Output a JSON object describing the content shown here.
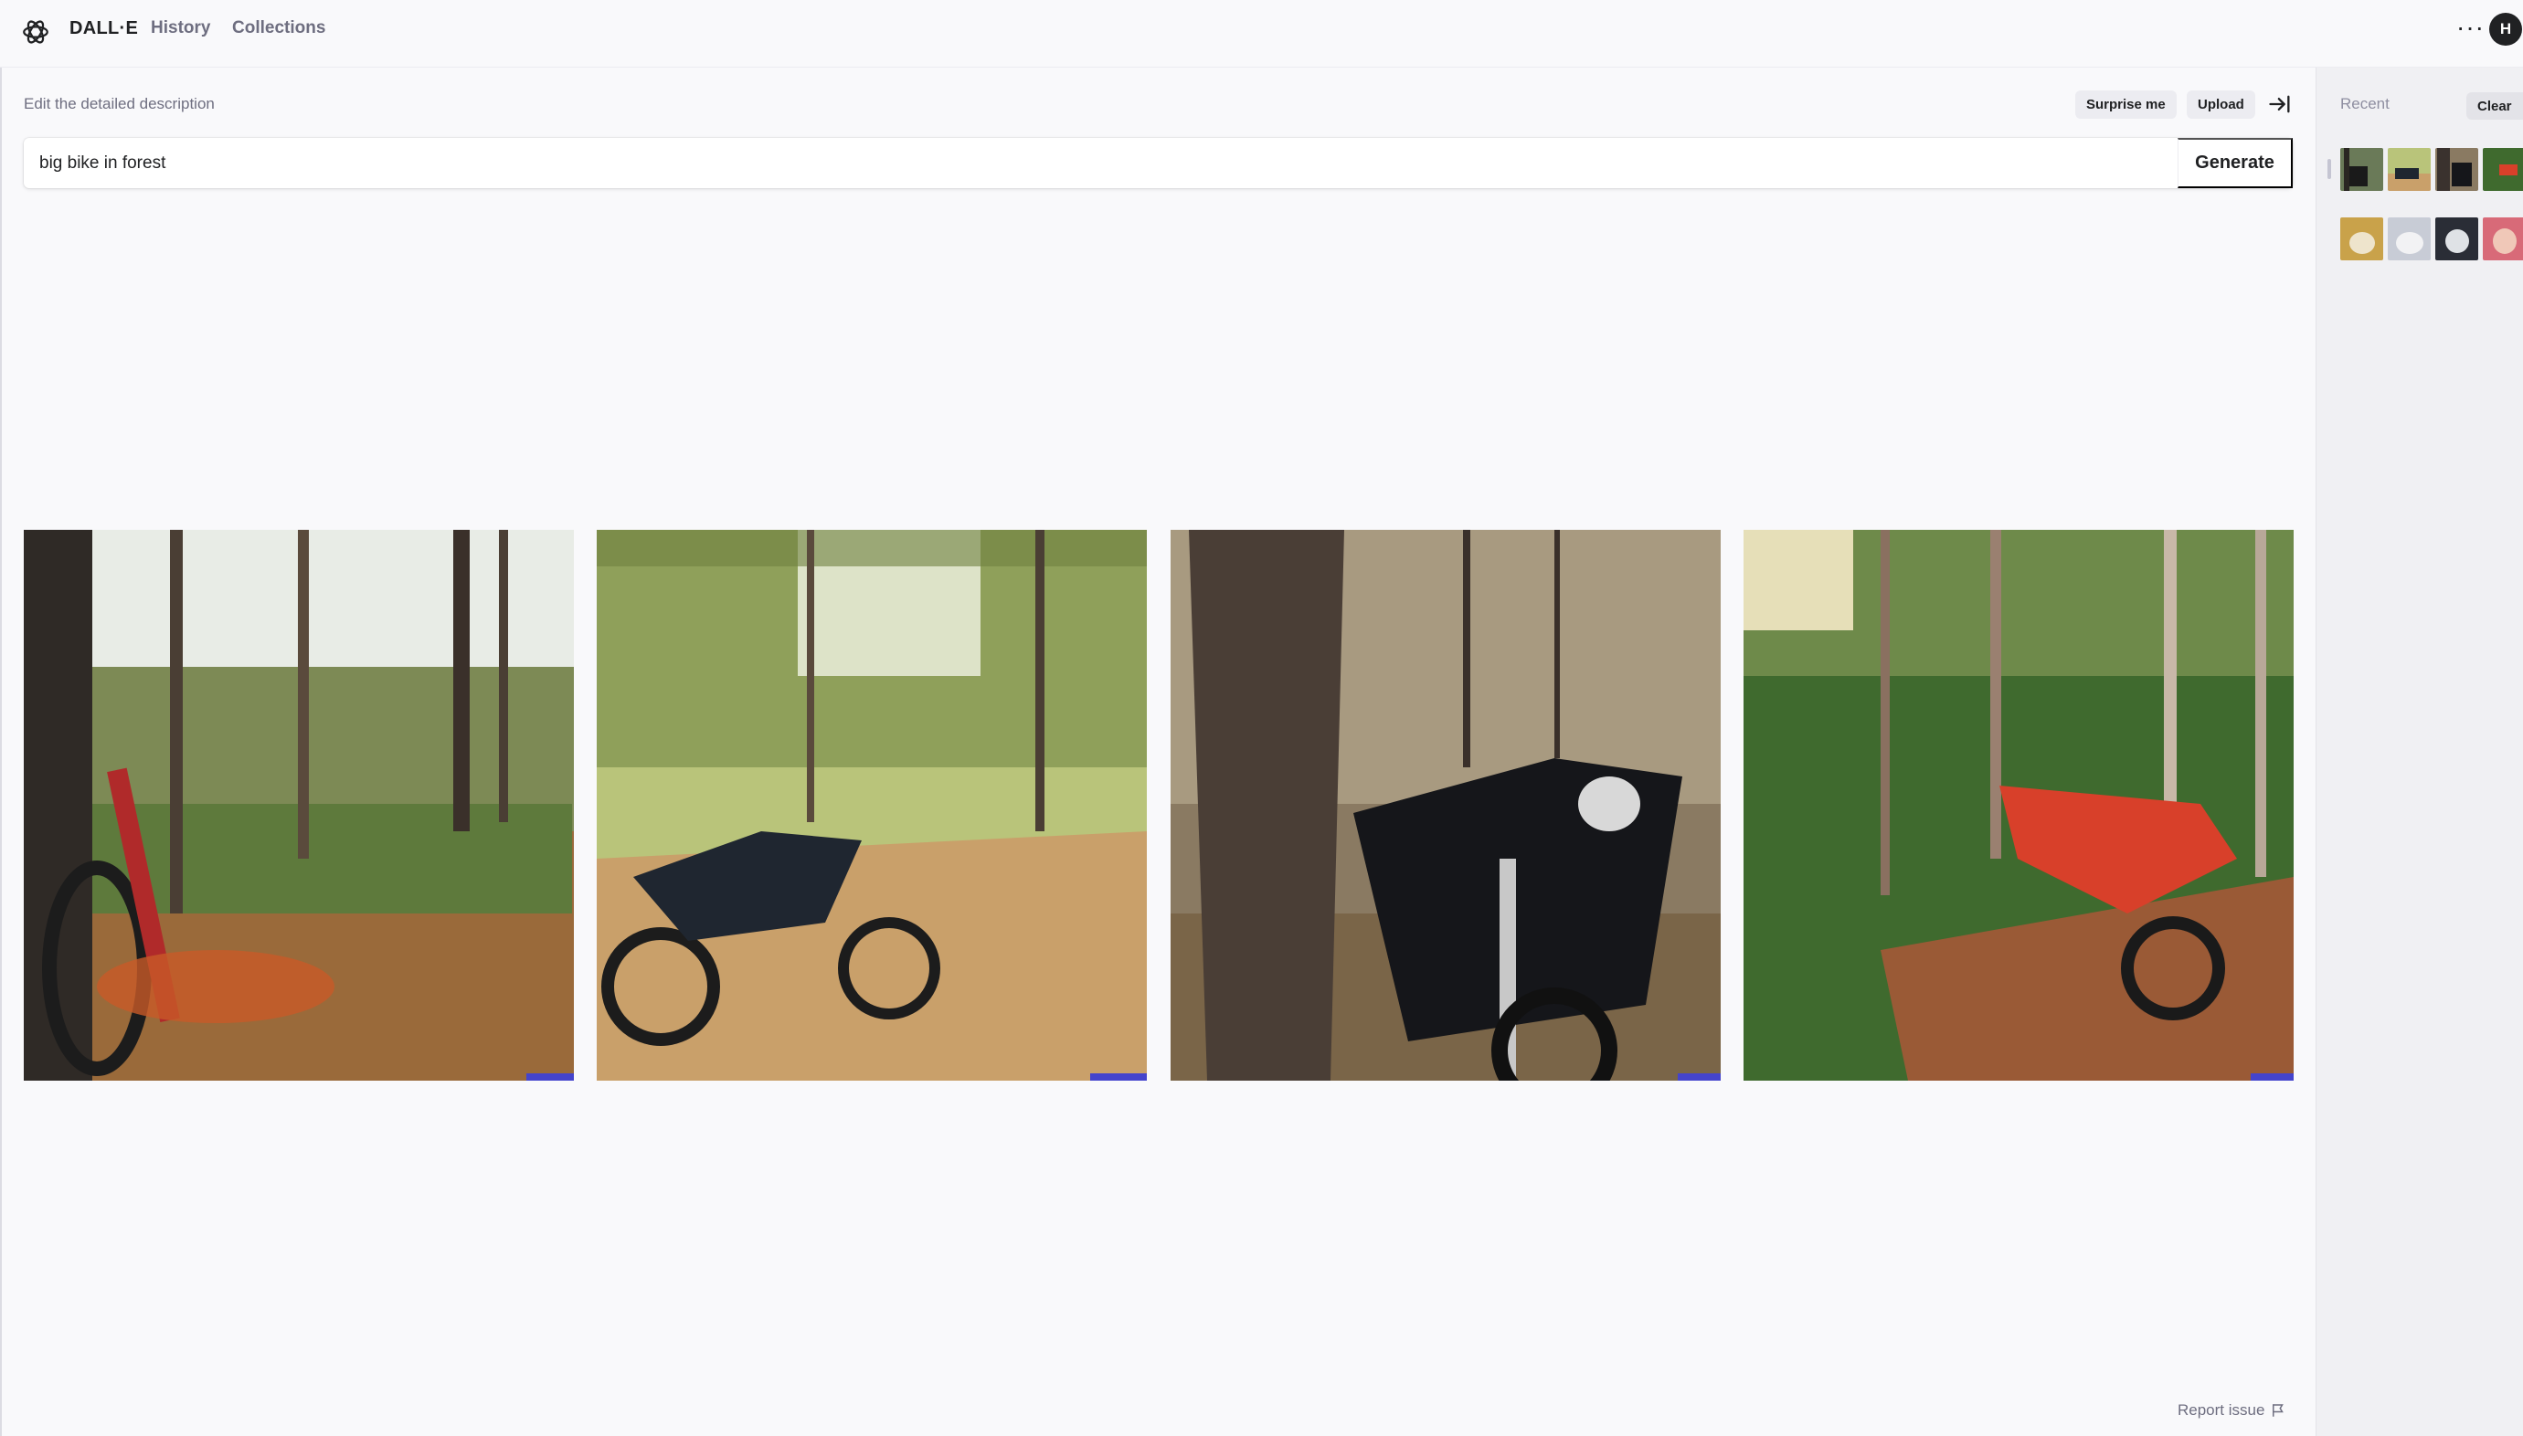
{
  "header": {
    "brand": "DALL·E",
    "nav": {
      "history": "History",
      "collections": "Collections"
    },
    "more_icon": "ellipsis-icon",
    "avatar_initial": "H"
  },
  "editor": {
    "label": "Edit the detailed description",
    "surprise_label": "Surprise me",
    "upload_label": "Upload",
    "prompt_value": "big bike in forest",
    "generate_label": "Generate"
  },
  "results": [
    {
      "subject": "bicycle leaning on tree in autumn forest"
    },
    {
      "subject": "black dirt bike on forest trail"
    },
    {
      "subject": "black motorcycle beside large tree trunk"
    },
    {
      "subject": "red dirt bike on forest path"
    }
  ],
  "footer": {
    "report_label": "Report issue"
  },
  "sidebar": {
    "recent_label": "Recent",
    "clear_label": "Clear",
    "thumbnails": 8
  },
  "colors": {
    "background": "#f9f9fb",
    "text": "#202123",
    "muted": "#6e6e80",
    "pill": "#ececf1",
    "sidebar": "#f0f0f3"
  }
}
